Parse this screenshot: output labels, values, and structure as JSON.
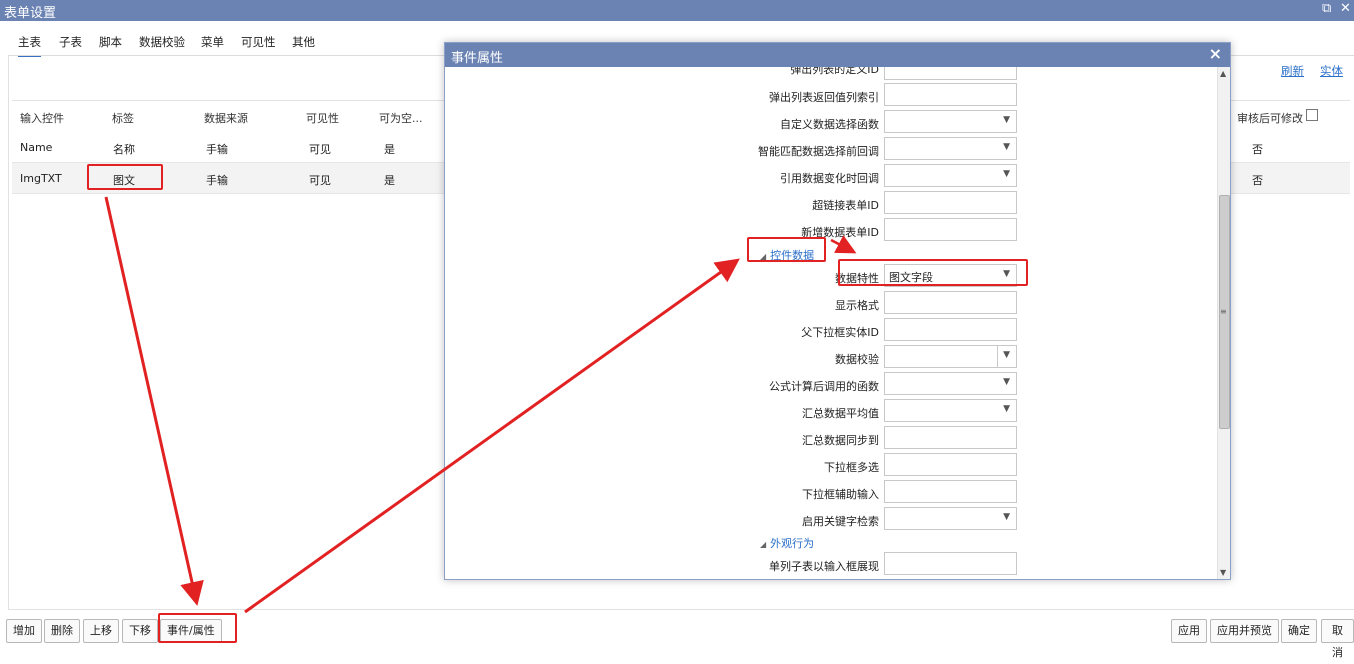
{
  "window": {
    "title": "表单设置",
    "restore_icon": "⧉",
    "close_icon": "✕"
  },
  "tabs": [
    "主表",
    "子表",
    "脚本",
    "数据校验",
    "菜单",
    "可见性",
    "其他"
  ],
  "links": {
    "refresh": "刷新",
    "entity": "实体"
  },
  "table": {
    "headers": [
      "输入控件",
      "标签",
      "数据来源",
      "可见性",
      "可为空...",
      "审核后可修改"
    ],
    "rows": [
      {
        "control": "Name",
        "label": "名称",
        "source": "手输",
        "visible": "可见",
        "nullable": "是",
        "editable": "否"
      },
      {
        "control": "ImgTXT",
        "label": "图文",
        "source": "手输",
        "visible": "可见",
        "nullable": "是",
        "editable": "否"
      }
    ]
  },
  "footer": {
    "left": [
      "增加",
      "删除",
      "上移",
      "下移",
      "事件/属性"
    ],
    "right": [
      "应用",
      "应用并预览",
      "确定",
      "取消"
    ]
  },
  "dialog": {
    "title": "事件属性",
    "close": "×",
    "top_partial_label": "弹出列表的定义ID",
    "props_a": [
      {
        "label": "弹出列表返回值列索引",
        "value": "",
        "dropdown": false
      },
      {
        "label": "自定义数据选择函数",
        "value": "",
        "dropdown": true
      },
      {
        "label": "智能匹配数据选择前回调",
        "value": "",
        "dropdown": true
      },
      {
        "label": "引用数据变化时回调",
        "value": "",
        "dropdown": true
      },
      {
        "label": "超链接表单ID",
        "value": "",
        "dropdown": false
      },
      {
        "label": "新增数据表单ID",
        "value": "",
        "dropdown": false
      }
    ],
    "section_control_data": "控件数据",
    "props_b": [
      {
        "label": "数据特性",
        "value": "图文字段",
        "dropdown": true
      },
      {
        "label": "显示格式",
        "value": "",
        "dropdown": false
      },
      {
        "label": "父下拉框实体ID",
        "value": "",
        "dropdown": false
      },
      {
        "label": "数据校验",
        "value": "",
        "dropdown": true
      },
      {
        "label": "公式计算后调用的函数",
        "value": "",
        "dropdown": true
      },
      {
        "label": "汇总数据平均值",
        "value": "",
        "dropdown": true
      },
      {
        "label": "汇总数据同步到",
        "value": "",
        "dropdown": false
      },
      {
        "label": "下拉框多选",
        "value": "",
        "dropdown": false
      },
      {
        "label": "下拉框辅助输入",
        "value": "",
        "dropdown": false
      },
      {
        "label": "启用关键字检索",
        "value": "",
        "dropdown": true
      }
    ],
    "section_appearance": "外观行为",
    "props_c": [
      {
        "label": "单列子表以输入框展现",
        "value": "",
        "dropdown": false
      }
    ]
  },
  "colors": {
    "titlebar": "#6b83b3",
    "link": "#2a6fc9",
    "annotation": "#e22222"
  },
  "icons": {
    "dropdown": "chevron-down-icon",
    "collapse": "triangle-icon",
    "scroll_up": "arrow-up-icon",
    "scroll_down": "arrow-down-icon"
  }
}
